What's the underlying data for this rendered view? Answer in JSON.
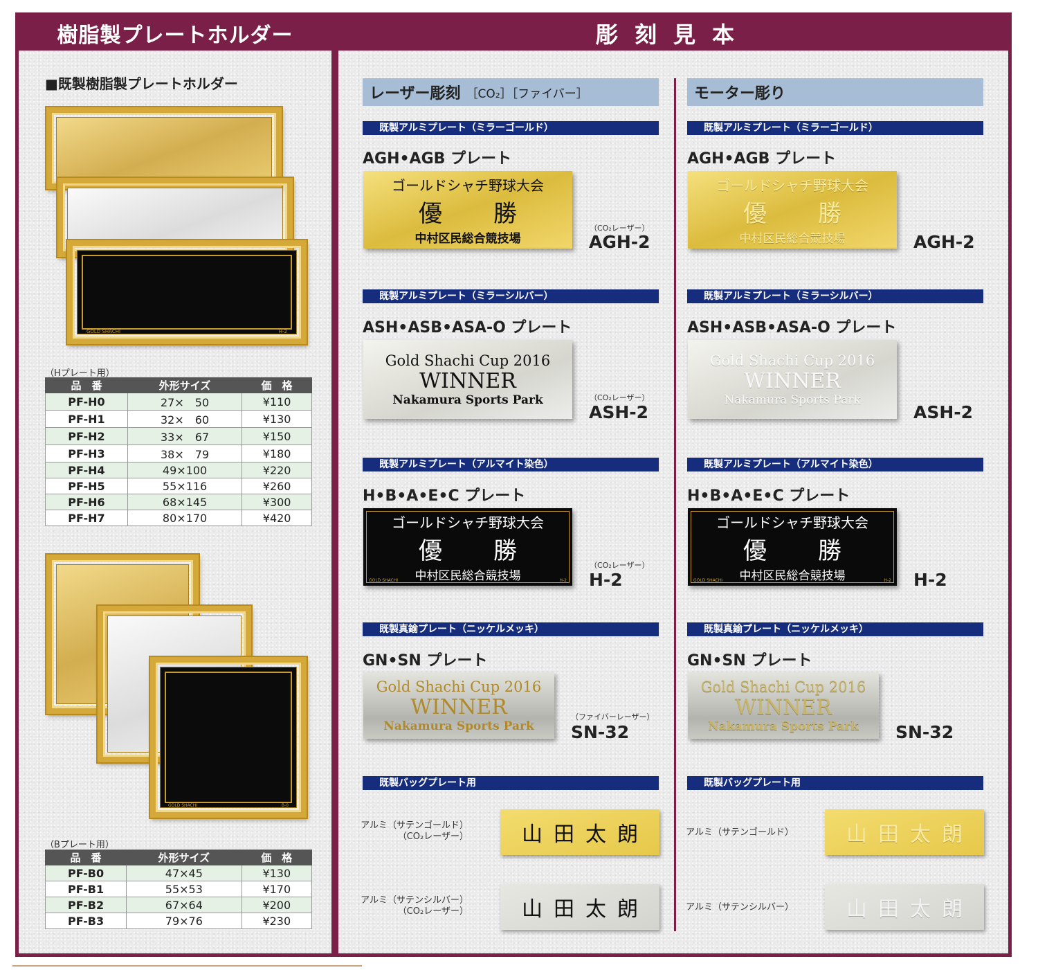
{
  "left": {
    "header": "樹脂製プレートホルダー",
    "subtitle": "■既製樹脂製プレートホルダー",
    "h_caption": "（Hプレート用）",
    "b_caption": "（Bプレート用）",
    "table_headers": [
      "品　番",
      "外形サイズ",
      "価　格"
    ],
    "h_rows": [
      [
        "PF-H0",
        "27×　50",
        "¥110"
      ],
      [
        "PF-H1",
        "32×　60",
        "¥130"
      ],
      [
        "PF-H2",
        "33×　67",
        "¥150"
      ],
      [
        "PF-H3",
        "38×　79",
        "¥180"
      ],
      [
        "PF-H4",
        "49×100",
        "¥220"
      ],
      [
        "PF-H5",
        "55×116",
        "¥260"
      ],
      [
        "PF-H6",
        "68×145",
        "¥300"
      ],
      [
        "PF-H7",
        "80×170",
        "¥420"
      ]
    ],
    "b_rows": [
      [
        "PF-B0",
        "47×45",
        "¥130"
      ],
      [
        "PF-B1",
        "55×53",
        "¥170"
      ],
      [
        "PF-B2",
        "67×64",
        "¥200"
      ],
      [
        "PF-B3",
        "79×76",
        "¥230"
      ]
    ],
    "frame_label_h": "GOLD SHACHI",
    "frame_code_h": "H-2",
    "frame_label_b": "GOLD SHACHI",
    "frame_code_b": "B-0"
  },
  "right": {
    "header": "彫刻見本",
    "laser": {
      "title": "レーザー彫刻",
      "sub": "［CO₂］［ファイバー］"
    },
    "motor": {
      "title": "モーター彫り"
    },
    "sections": [
      "既製アルミプレート（ミラーゴールド）",
      "既製アルミプレート（ミラーシルバー）",
      "既製アルミプレート（アルマイト染色）",
      "既製真鍮プレート（ニッケルメッキ）",
      "既製バッグプレート用"
    ],
    "products": [
      "AGH•AGB プレート",
      "ASH•ASB•ASA-O プレート",
      "H•B•A•E•C プレート",
      "GN•SN プレート"
    ],
    "jp_plate": {
      "l1": "ゴールドシャチ野球大会",
      "l2": "優　勝",
      "l3": "中村区民総合競技場"
    },
    "en_plate": {
      "l1": "Gold Shachi Cup 2016",
      "l2": "WINNER",
      "l3": "Nakamura Sports Park"
    },
    "plate_footer_left": "GOLD SHACHI",
    "plate_footer_right": "H-2",
    "models": [
      "AGH-2",
      "ASH-2",
      "H-2",
      "SN-32"
    ],
    "notes": {
      "co2": "（CO₂レーザー）",
      "fiber": "（ファイバーレーザー）"
    },
    "bag": {
      "name": "山田太朗",
      "laser_gold": [
        "アルミ（サテンゴールド）",
        "（CO₂レーザー）"
      ],
      "laser_silver": [
        "アルミ（サテンシルバー）",
        "（CO₂レーザー）"
      ],
      "motor_gold": "アルミ（サテンゴールド）",
      "motor_silver": "アルミ（サテンシルバー）"
    }
  },
  "colors": {
    "maroon": "#7a1f47",
    "navy_bar": "#162c7c",
    "column_title_blue": "#a7bdd6",
    "table_header": "#555555",
    "table_stripe": "#e6f1e6"
  }
}
